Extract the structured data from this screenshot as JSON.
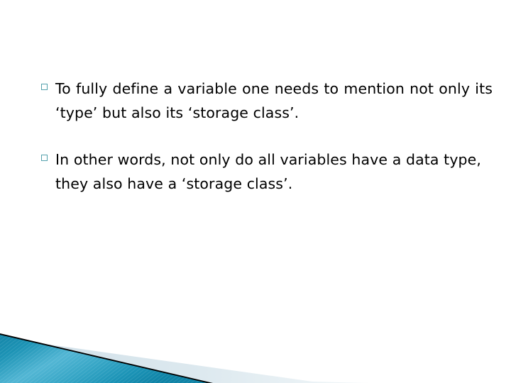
{
  "slide": {
    "background_color": "#ffffff",
    "bullets": [
      {
        "marker": "hollow-square-bullet",
        "marker_color": "#53a0ac",
        "text": "To fully define a variable one needs to mention not only its ‘type’ but also its ‘storage class’."
      },
      {
        "marker": "hollow-square-bullet",
        "marker_color": "#53a0ac",
        "text": "In other words, not only do all variables have a data type, they also have a ‘storage class’."
      }
    ]
  },
  "decor": {
    "name": "bottom-left-diagonal-banner",
    "teal_light": "#63c0db",
    "teal_mid": "#1f9bbd",
    "teal_dark": "#0f7fa3",
    "black": "#000000",
    "pale_blue": "#dbe7ed"
  }
}
